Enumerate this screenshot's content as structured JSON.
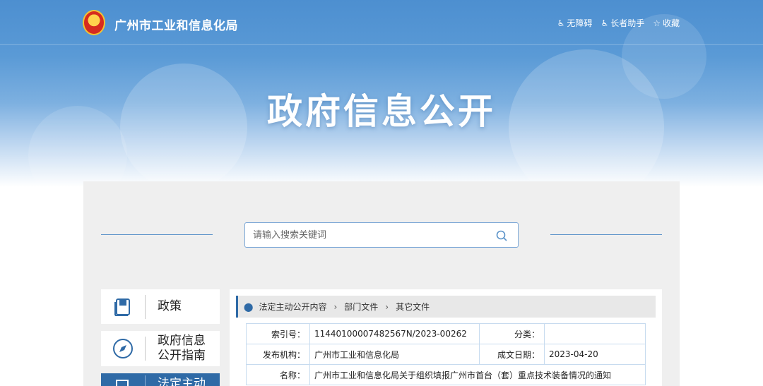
{
  "header": {
    "site_title": "广州市工业和信息化局",
    "tools": [
      {
        "icon": "accessibility-icon",
        "label": "无障碍"
      },
      {
        "icon": "elder-icon",
        "label": "长者助手"
      },
      {
        "icon": "star-icon",
        "label": "收藏"
      }
    ]
  },
  "banner": {
    "title": "政府信息公开"
  },
  "search": {
    "placeholder": "请输入搜索关键词"
  },
  "sidebar": {
    "items": [
      {
        "label": "政策",
        "icon": "book-icon"
      },
      {
        "label": "政府信息公开指南",
        "icon": "compass-icon"
      },
      {
        "label": "法定主动",
        "icon": "document-icon",
        "active": true
      }
    ]
  },
  "breadcrumb": {
    "icon": "location-pin-icon",
    "items": [
      "法定主动公开内容",
      "部门文件",
      "其它文件"
    ]
  },
  "info": {
    "index_label": "索引号：",
    "index_value": "11440100007482567N/2023-00262",
    "category_label": "分类：",
    "category_value": "",
    "publisher_label": "发布机构：",
    "publisher_value": "广州市工业和信息化局",
    "date_label": "成文日期：",
    "date_value": "2023-04-20",
    "name_label": "名称：",
    "name_value": "广州市工业和信息化局关于组织填报广州市首台（套）重点技术装备情况的通知"
  },
  "colors": {
    "brand_blue": "#2f6aa6",
    "banner_blue": "#5a9ad6",
    "panel_gray": "#efefef"
  }
}
